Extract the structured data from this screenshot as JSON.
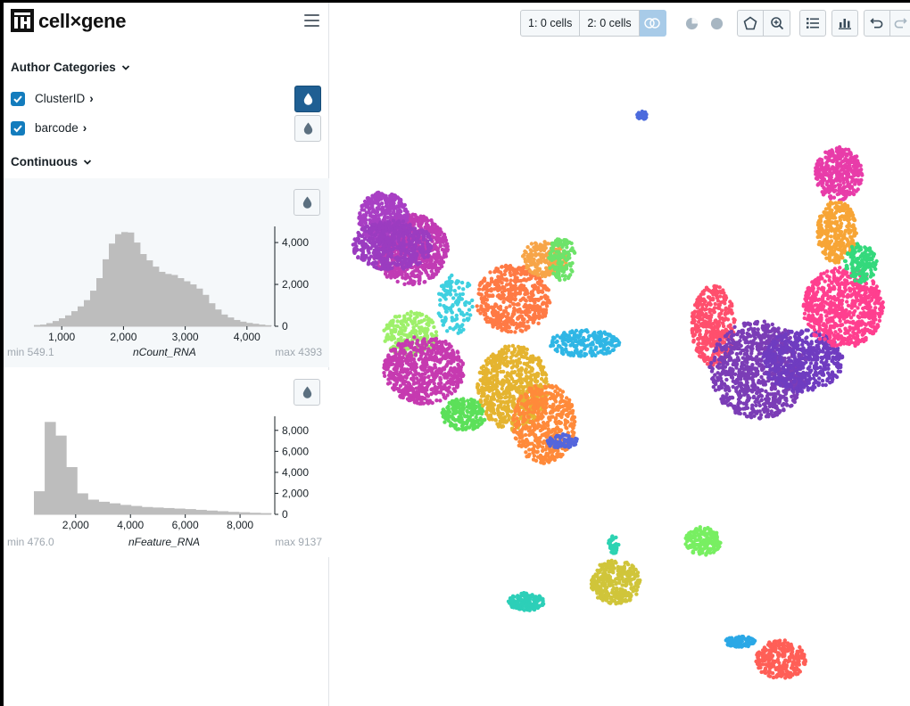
{
  "app": {
    "title": "cell×gene"
  },
  "sidebar": {
    "author_categories_label": "Author Categories",
    "categories": [
      {
        "label": "ClusterID",
        "checked": true,
        "color_active": true
      },
      {
        "label": "barcode",
        "checked": true,
        "color_active": false
      }
    ],
    "continuous_label": "Continuous",
    "histograms": [
      {
        "name": "nCount_RNA",
        "min_label": "min 549.1",
        "max_label": "max 4393",
        "x_ticks": [
          "1,000",
          "2,000",
          "3,000",
          "4,000"
        ],
        "y_ticks": [
          "4,000",
          "2,000",
          "0"
        ],
        "color_active": false
      },
      {
        "name": "nFeature_RNA",
        "min_label": "min 476.0",
        "max_label": "max 9137",
        "x_ticks": [
          "2,000",
          "4,000",
          "6,000",
          "8,000"
        ],
        "y_ticks": [
          "8,000",
          "6,000",
          "4,000",
          "2,000",
          "0"
        ],
        "color_active": false
      }
    ]
  },
  "toolbar": {
    "selection_1": "1: 0 cells",
    "selection_2": "2: 0 cells",
    "icons": [
      "venn-icon",
      "pie-icon",
      "circle-icon",
      "lasso-icon",
      "zoom-in-icon",
      "list-icon",
      "bar-chart-icon",
      "undo-icon",
      "redo-icon"
    ]
  },
  "chart_data": [
    {
      "type": "bar",
      "title": "",
      "xlabel": "nCount_RNA",
      "ylabel": "",
      "xlim": [
        549.1,
        4393
      ],
      "ylim": [
        0,
        4600
      ],
      "x": [
        630,
        730,
        830,
        930,
        1030,
        1130,
        1230,
        1330,
        1430,
        1530,
        1630,
        1730,
        1830,
        1930,
        2030,
        2130,
        2230,
        2330,
        2430,
        2530,
        2630,
        2730,
        2830,
        2930,
        3030,
        3130,
        3230,
        3330,
        3430,
        3530,
        3630,
        3730,
        3830,
        3930,
        4030,
        4130,
        4230,
        4330
      ],
      "values": [
        60,
        80,
        150,
        250,
        380,
        520,
        720,
        950,
        1250,
        1700,
        2300,
        3200,
        3950,
        4400,
        4500,
        4480,
        4000,
        3450,
        3150,
        2850,
        2600,
        2500,
        2450,
        2300,
        2150,
        2000,
        1800,
        1500,
        1100,
        800,
        560,
        420,
        300,
        220,
        160,
        120,
        80,
        50
      ]
    },
    {
      "type": "bar",
      "title": "",
      "xlabel": "nFeature_RNA",
      "ylabel": "",
      "xlim": [
        476.0,
        9137
      ],
      "ylim": [
        0,
        9000
      ],
      "x": [
        700,
        1100,
        1500,
        1900,
        2300,
        2700,
        3100,
        3500,
        3900,
        4300,
        4700,
        5100,
        5500,
        5900,
        6300,
        6700,
        7100,
        7500,
        7900,
        8300,
        8700,
        9100
      ],
      "values": [
        2200,
        8800,
        7500,
        4500,
        2000,
        1400,
        1200,
        1050,
        900,
        800,
        700,
        650,
        600,
        550,
        500,
        430,
        360,
        300,
        240,
        200,
        150,
        120
      ]
    }
  ]
}
